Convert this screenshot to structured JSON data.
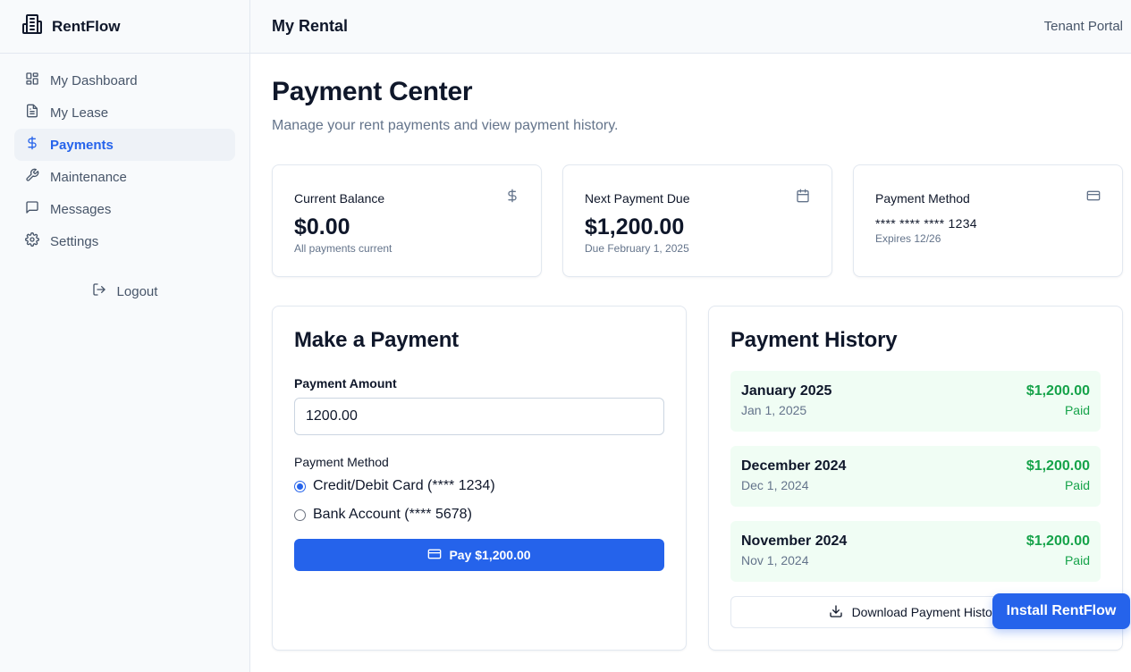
{
  "app": {
    "name": "RentFlow"
  },
  "sidebar": {
    "items": [
      {
        "label": "My Dashboard",
        "icon": "dashboard-icon"
      },
      {
        "label": "My Lease",
        "icon": "document-icon"
      },
      {
        "label": "Payments",
        "icon": "dollar-icon",
        "active": true
      },
      {
        "label": "Maintenance",
        "icon": "wrench-icon"
      },
      {
        "label": "Messages",
        "icon": "message-icon"
      },
      {
        "label": "Settings",
        "icon": "gear-icon"
      }
    ],
    "logout_label": "Logout"
  },
  "header": {
    "title": "My Rental",
    "right_text": "Tenant Portal"
  },
  "page": {
    "title": "Payment Center",
    "subtitle": "Manage your rent payments and view payment history."
  },
  "cards": {
    "balance": {
      "label": "Current Balance",
      "value": "$0.00",
      "note": "All payments current"
    },
    "next_due": {
      "label": "Next Payment Due",
      "value": "$1,200.00",
      "note": "Due February 1, 2025"
    },
    "method": {
      "label": "Payment Method",
      "value": "**** **** **** 1234",
      "note": "Expires 12/26"
    }
  },
  "make_payment": {
    "title": "Make a Payment",
    "amount_label": "Payment Amount",
    "amount_value": "1200.00",
    "method_label": "Payment Method",
    "options": [
      {
        "label": "Credit/Debit Card (**** 1234)",
        "checked": true
      },
      {
        "label": "Bank Account (**** 5678)",
        "checked": false
      }
    ],
    "pay_label": "Pay $1,200.00"
  },
  "history": {
    "title": "Payment History",
    "items": [
      {
        "month": "January 2025",
        "date": "Jan 1, 2025",
        "amount": "$1,200.00",
        "status": "Paid"
      },
      {
        "month": "December 2024",
        "date": "Dec 1, 2024",
        "amount": "$1,200.00",
        "status": "Paid"
      },
      {
        "month": "November 2024",
        "date": "Nov 1, 2024",
        "amount": "$1,200.00",
        "status": "Paid"
      }
    ],
    "download_label": "Download Payment History"
  },
  "install_label": "Install RentFlow",
  "colors": {
    "accent": "#2563eb",
    "success": "#16a34a",
    "success_bg": "#f0fdf4"
  }
}
